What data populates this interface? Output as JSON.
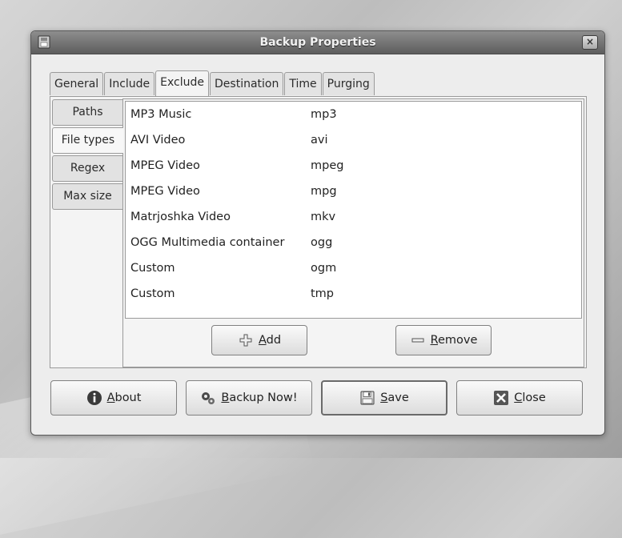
{
  "window": {
    "title": "Backup Properties",
    "close_glyph": "×"
  },
  "tabs": [
    {
      "label": "General",
      "active": false
    },
    {
      "label": "Include",
      "active": false
    },
    {
      "label": "Exclude",
      "active": true
    },
    {
      "label": "Destination",
      "active": false
    },
    {
      "label": "Time",
      "active": false
    },
    {
      "label": "Purging",
      "active": false
    }
  ],
  "subtabs": [
    {
      "label": "Paths",
      "active": false
    },
    {
      "label": "File types",
      "active": true
    },
    {
      "label": "Regex",
      "active": false
    },
    {
      "label": "Max size",
      "active": false
    }
  ],
  "filetypes": [
    {
      "name": "MP3 Music",
      "ext": "mp3"
    },
    {
      "name": "AVI Video",
      "ext": "avi"
    },
    {
      "name": "MPEG Video",
      "ext": "mpeg"
    },
    {
      "name": "MPEG Video",
      "ext": "mpg"
    },
    {
      "name": "Matrjoshka Video",
      "ext": "mkv"
    },
    {
      "name": "OGG Multimedia container",
      "ext": "ogg"
    },
    {
      "name": "Custom",
      "ext": "ogm"
    },
    {
      "name": "Custom",
      "ext": "tmp"
    }
  ],
  "list_buttons": {
    "add": {
      "mnemonic": "A",
      "rest": "dd",
      "icon": "plus-icon"
    },
    "remove": {
      "mnemonic": "R",
      "rest": "emove",
      "icon": "minus-icon"
    }
  },
  "footer_buttons": {
    "about": {
      "mnemonic": "A",
      "rest": "bout",
      "icon": "info-icon"
    },
    "backup": {
      "mnemonic": "B",
      "rest": "ackup Now!",
      "icon": "gears-icon"
    },
    "save": {
      "mnemonic": "S",
      "rest": "ave",
      "icon": "floppy-disk-icon"
    },
    "close": {
      "mnemonic": "C",
      "rest": "lose",
      "icon": "close-x-icon"
    }
  }
}
